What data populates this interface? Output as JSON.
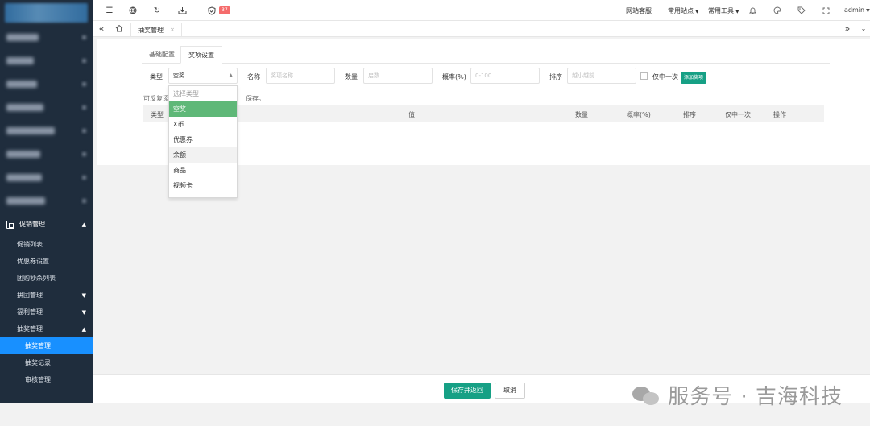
{
  "sidebar": {
    "group_label": "促销管理",
    "items": [
      {
        "label": "促销列表"
      },
      {
        "label": "优惠券设置"
      },
      {
        "label": "团购秒杀列表"
      },
      {
        "label": "拼团管理"
      },
      {
        "label": "福利管理"
      },
      {
        "label": "抽奖管理"
      }
    ],
    "sub_items": [
      {
        "label": "抽奖管理"
      },
      {
        "label": "抽奖记录"
      },
      {
        "label": "审核管理"
      }
    ]
  },
  "topbar": {
    "badge_count": "37",
    "links": {
      "customer_service": "网站客服",
      "common_sites": "常用站点",
      "common_tools": "常用工具",
      "user": "admin"
    }
  },
  "tabs": {
    "active_tab": "抽奖管理"
  },
  "subtabs": [
    "基础配置",
    "奖项设置"
  ],
  "form": {
    "type_label": "类型",
    "type_value": "空奖",
    "name_label": "名称",
    "name_placeholder": "奖项名称",
    "quantity_label": "数量",
    "quantity_placeholder": "启数",
    "probability_label": "概率(%)",
    "probability_placeholder": "0-100",
    "sort_label": "排序",
    "sort_placeholder": "越小越前",
    "once_only_label": "仅中一次",
    "add_button": "添加奖项"
  },
  "tip": {
    "lead": "可反复添",
    "tail": "保存。"
  },
  "table": {
    "headers": [
      "类型",
      "值",
      "数量",
      "概率(%)",
      "排序",
      "仅中一次",
      "操作"
    ]
  },
  "dropdown": {
    "options": [
      "选择类型",
      "空奖",
      "X币",
      "优惠券",
      "余额",
      "商品",
      "视频卡"
    ],
    "selected": "空奖",
    "hovered": "余额"
  },
  "footer": {
    "save_button": "保存并返回",
    "cancel_button": "取消"
  },
  "watermark": {
    "text": "服务号 · 吉海科技"
  },
  "colors": {
    "sidebar_bg": "#1f2d3d",
    "active_blue": "#1890ff",
    "primary_green": "#16a085",
    "selected_option": "#5fb878",
    "badge_red": "#f56c6c"
  }
}
